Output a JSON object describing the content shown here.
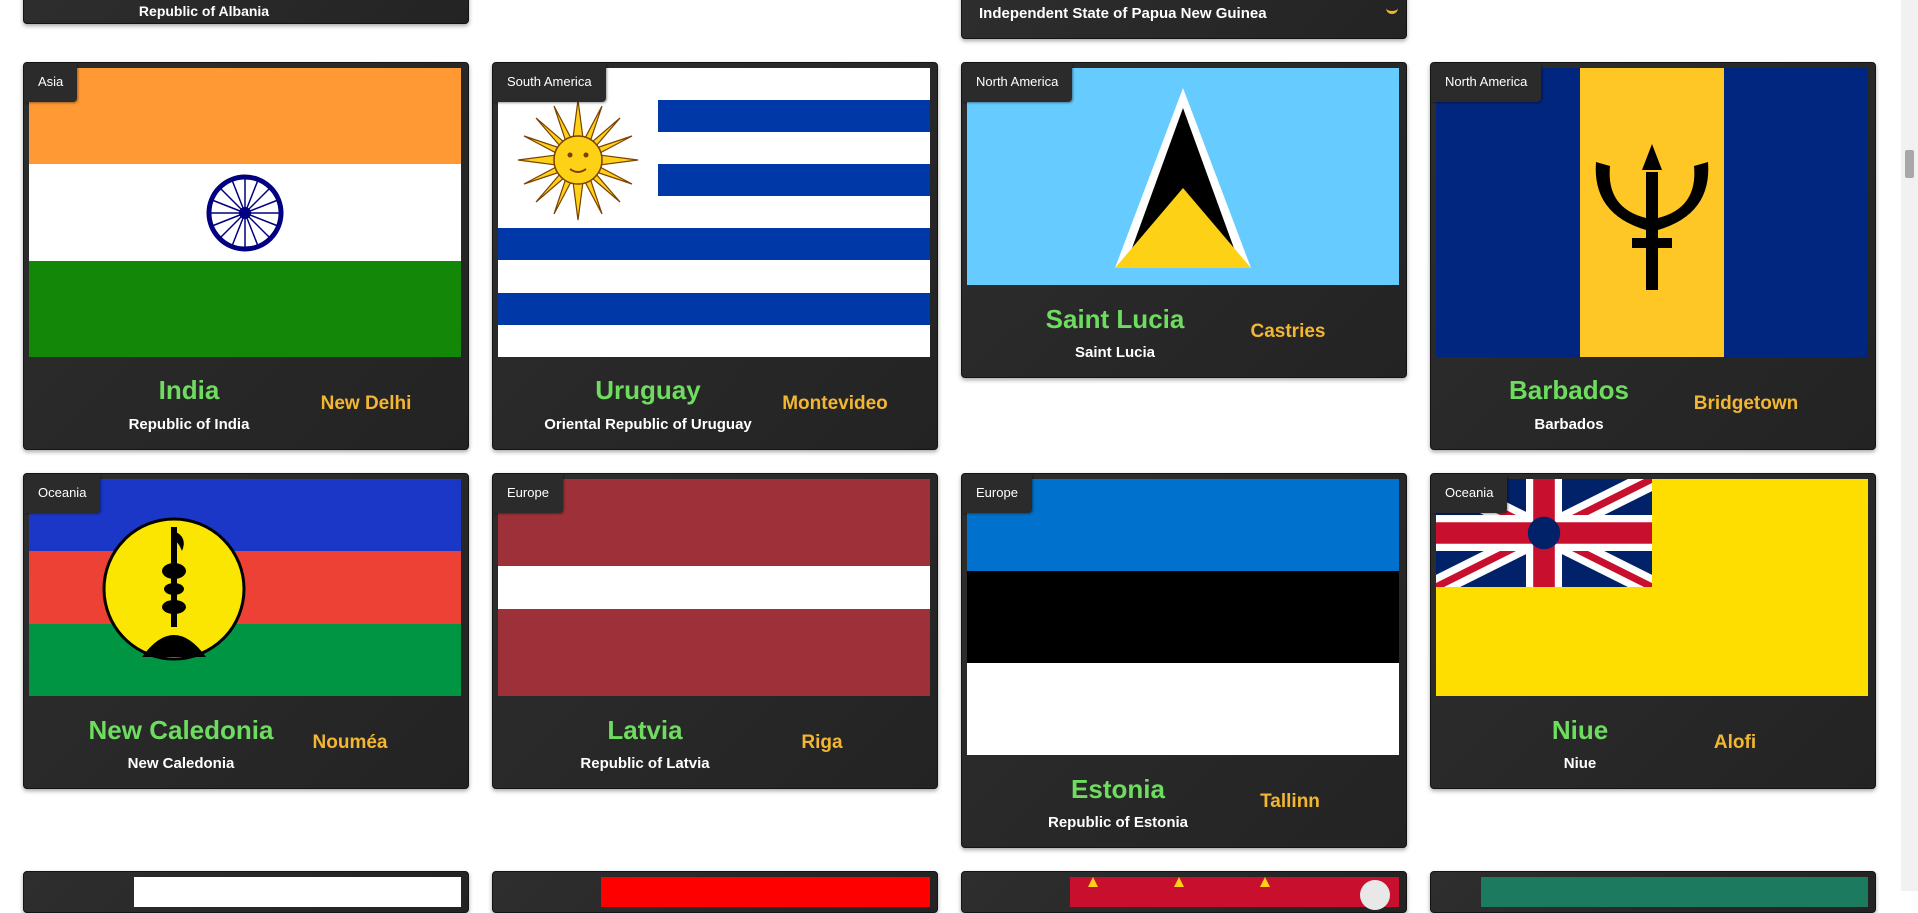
{
  "top_partial": {
    "card1_official": "Republic of Albania",
    "card3_official": "Independent State of Papua New Guinea"
  },
  "cards": [
    {
      "region": "Asia",
      "name": "India",
      "official": "Republic of India",
      "capital": "New Delhi",
      "flag_icon": "india-flag"
    },
    {
      "region": "South America",
      "name": "Uruguay",
      "official": "Oriental Republic of Uruguay",
      "capital": "Montevideo",
      "flag_icon": "uruguay-flag"
    },
    {
      "region": "North America",
      "name": "Saint Lucia",
      "official": "Saint Lucia",
      "capital": "Castries",
      "flag_icon": "saint-lucia-flag"
    },
    {
      "region": "North America",
      "name": "Barbados",
      "official": "Barbados",
      "capital": "Bridgetown",
      "flag_icon": "barbados-flag"
    },
    {
      "region": "Oceania",
      "name": "New Caledonia",
      "official": "New Caledonia",
      "capital": "Nouméa",
      "flag_icon": "new-caledonia-flag"
    },
    {
      "region": "Europe",
      "name": "Latvia",
      "official": "Republic of Latvia",
      "capital": "Riga",
      "flag_icon": "latvia-flag"
    },
    {
      "region": "Europe",
      "name": "Estonia",
      "official": "Republic of Estonia",
      "capital": "Tallinn",
      "flag_icon": "estonia-flag"
    },
    {
      "region": "Oceania",
      "name": "Niue",
      "official": "Niue",
      "capital": "Alofi",
      "flag_icon": "niue-flag"
    }
  ],
  "colors": {
    "card_bg": "#2b2b2b",
    "name_green": "#6edc5f",
    "capital_gold": "#f2b632"
  }
}
